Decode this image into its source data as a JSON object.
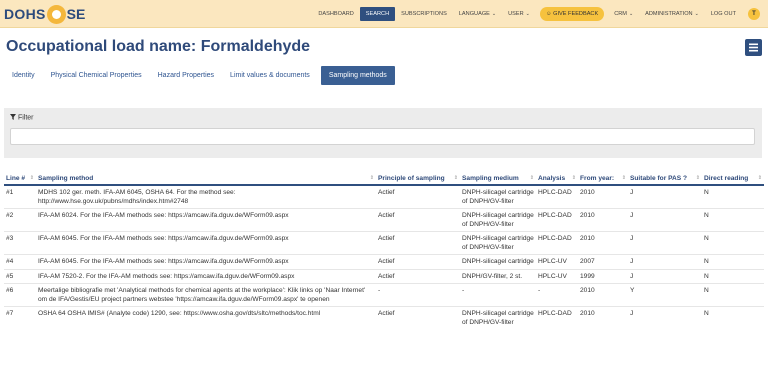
{
  "navbar": {
    "logo_prefix": "DOHS",
    "logo_suffix": "SE",
    "items": [
      {
        "label": "DASHBOARD",
        "active": false,
        "caret": false
      },
      {
        "label": "SEARCH",
        "active": true,
        "caret": false
      },
      {
        "label": "SUBSCRIPTIONS",
        "active": false,
        "caret": false
      },
      {
        "label": "LANGUAGE",
        "active": false,
        "caret": true
      },
      {
        "label": "USER",
        "active": false,
        "caret": true
      }
    ],
    "feedback_label": "GIVE FEEDBACK",
    "items_after": [
      {
        "label": "CRM",
        "caret": true
      },
      {
        "label": "ADMINISTRATION",
        "caret": true
      },
      {
        "label": "LOG OUT",
        "caret": false
      }
    ],
    "user_initial": "T"
  },
  "page": {
    "title": "Occupational load name: Formaldehyde"
  },
  "tabs": [
    {
      "label": "Identity",
      "active": false
    },
    {
      "label": "Physical Chemical Properties",
      "active": false
    },
    {
      "label": "Hazard Properties",
      "active": false
    },
    {
      "label": "Limit values & documents",
      "active": false
    },
    {
      "label": "Sampling methods",
      "active": true
    }
  ],
  "filter": {
    "title": "Filter",
    "value": ""
  },
  "table": {
    "columns": [
      "Line #",
      "Sampling method",
      "Principle of sampling",
      "Sampling medium",
      "Analysis",
      "From year:",
      "Suitable for PAS ?",
      "Direct reading"
    ],
    "rows": [
      [
        "#1",
        "MDHS 102 ger. meth. IFA-AM 6045, OSHA 64. For the method see: http://www.hse.gov.uk/pubns/mdhs/index.htm#2748",
        "Actief",
        "DNPH-silicagel cartridge of DNPH/GV-filter",
        "HPLC-DAD",
        "2010",
        "J",
        "N"
      ],
      [
        "#2",
        "IFA-AM 6024. For the IFA-AM methods see: https://amcaw.ifa.dguv.de/WForm09.aspx",
        "Actief",
        "DNPH-silicagel cartridge of DNPH/GV-filter",
        "HPLC-DAD",
        "2010",
        "J",
        "N"
      ],
      [
        "#3",
        "IFA-AM 6045. For the IFA-AM methods see: https://amcaw.ifa.dguv.de/WForm09.aspx",
        "Actief",
        "DNPH-silicagel cartridge of DNPH/GV-filter",
        "HPLC-DAD",
        "2010",
        "J",
        "N"
      ],
      [
        "#4",
        "IFA-AM 6045. For the IFA-AM methods see: https://amcaw.ifa.dguv.de/WForm09.aspx",
        "Actief",
        "DNPH-silicagel cartridge",
        "HPLC-UV",
        "2007",
        "J",
        "N"
      ],
      [
        "#5",
        "IFA-AM 7520-2. For the IFA-AM methods see: https://amcaw.ifa.dguv.de/WForm09.aspx",
        "Actief",
        "DNPH/GV-filter, 2 st.",
        "HPLC-UV",
        "1999",
        "J",
        "N"
      ],
      [
        "#6",
        "Meertalige bibliografie met 'Analytical methods for chemical agents at the workplace': Klik links op 'Naar Internet' om de IFA/Gestis/EU project partners webstee 'https://amcaw.ifa.dguv.de/WForm09.aspx' te openen",
        "-",
        "-",
        "-",
        "2010",
        "Y",
        "N"
      ],
      [
        "#7",
        "OSHA 64 OSHA IMIS# (Analyte code) 1290, see: https://www.osha.gov/dts/sltc/methods/toc.html",
        "Actief",
        "DNPH-silicagel cartridge of DNPH/GV-filter",
        "HPLC-DAD",
        "2010",
        "J",
        "N"
      ]
    ]
  },
  "colors": {
    "navbar_bg": "#fbe7bf",
    "primary": "#2f4f7f",
    "title": "#2f4a7a",
    "feedback": "#f6c23e"
  }
}
